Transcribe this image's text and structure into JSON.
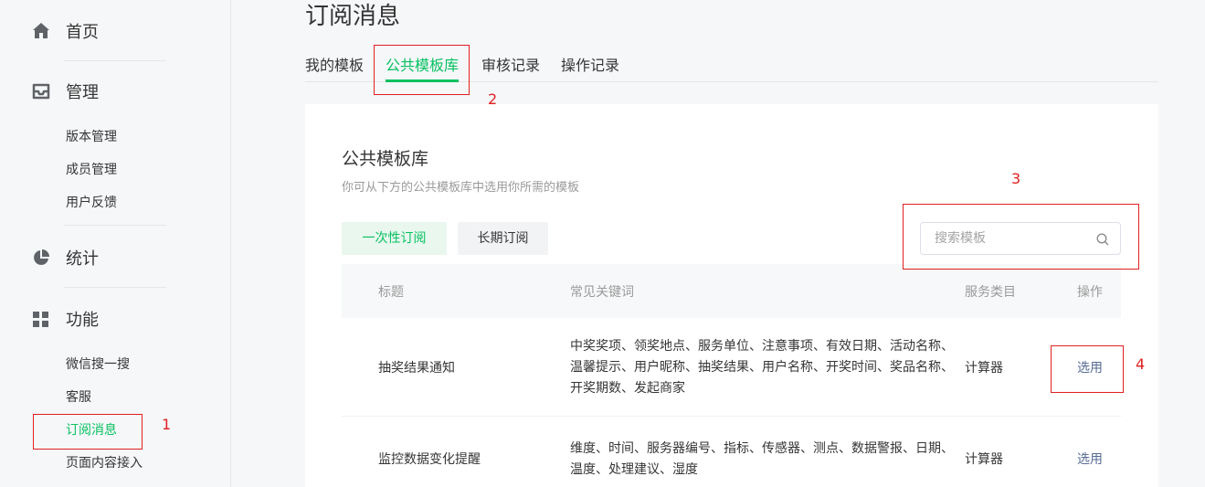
{
  "sidebar": {
    "sections": [
      {
        "label": "首页"
      },
      {
        "label": "管理",
        "items": [
          "版本管理",
          "成员管理",
          "用户反馈"
        ]
      },
      {
        "label": "统计"
      },
      {
        "label": "功能",
        "items": [
          "微信搜一搜",
          "客服",
          "订阅消息",
          "页面内容接入"
        ]
      }
    ]
  },
  "page": {
    "title": "订阅消息",
    "tabs": [
      "我的模板",
      "公共模板库",
      "审核记录",
      "操作记录"
    ],
    "active_tab": "公共模板库"
  },
  "library": {
    "title": "公共模板库",
    "description": "你可从下方的公共模板库中选用你所需的模板",
    "filter_buttons": [
      "一次性订阅",
      "长期订阅"
    ],
    "search_placeholder": "搜索模板"
  },
  "table": {
    "headers": [
      "标题",
      "常见关键词",
      "服务类目",
      "操作"
    ],
    "rows": [
      {
        "title": "抽奖结果通知",
        "keywords_lines": [
          "中奖奖项、领奖地点、服务单位、注意事项、有效日期、活动名称、",
          "温馨提示、用户昵称、抽奖结果、用户名称、开奖时间、奖品名称、",
          "开奖期数、发起商家"
        ],
        "category": "计算器",
        "action": "选用"
      },
      {
        "title": "监控数据变化提醒",
        "keywords_lines": [
          "维度、时间、服务器编号、指标、传感器、测点、数据警报、日期、",
          "温度、处理建议、湿度"
        ],
        "category": "计算器",
        "action": "选用"
      }
    ]
  },
  "annotations": [
    "1",
    "2",
    "3",
    "4"
  ],
  "colors": {
    "accent": "#07c160",
    "link": "#576b95",
    "annotation": "#e02020"
  }
}
